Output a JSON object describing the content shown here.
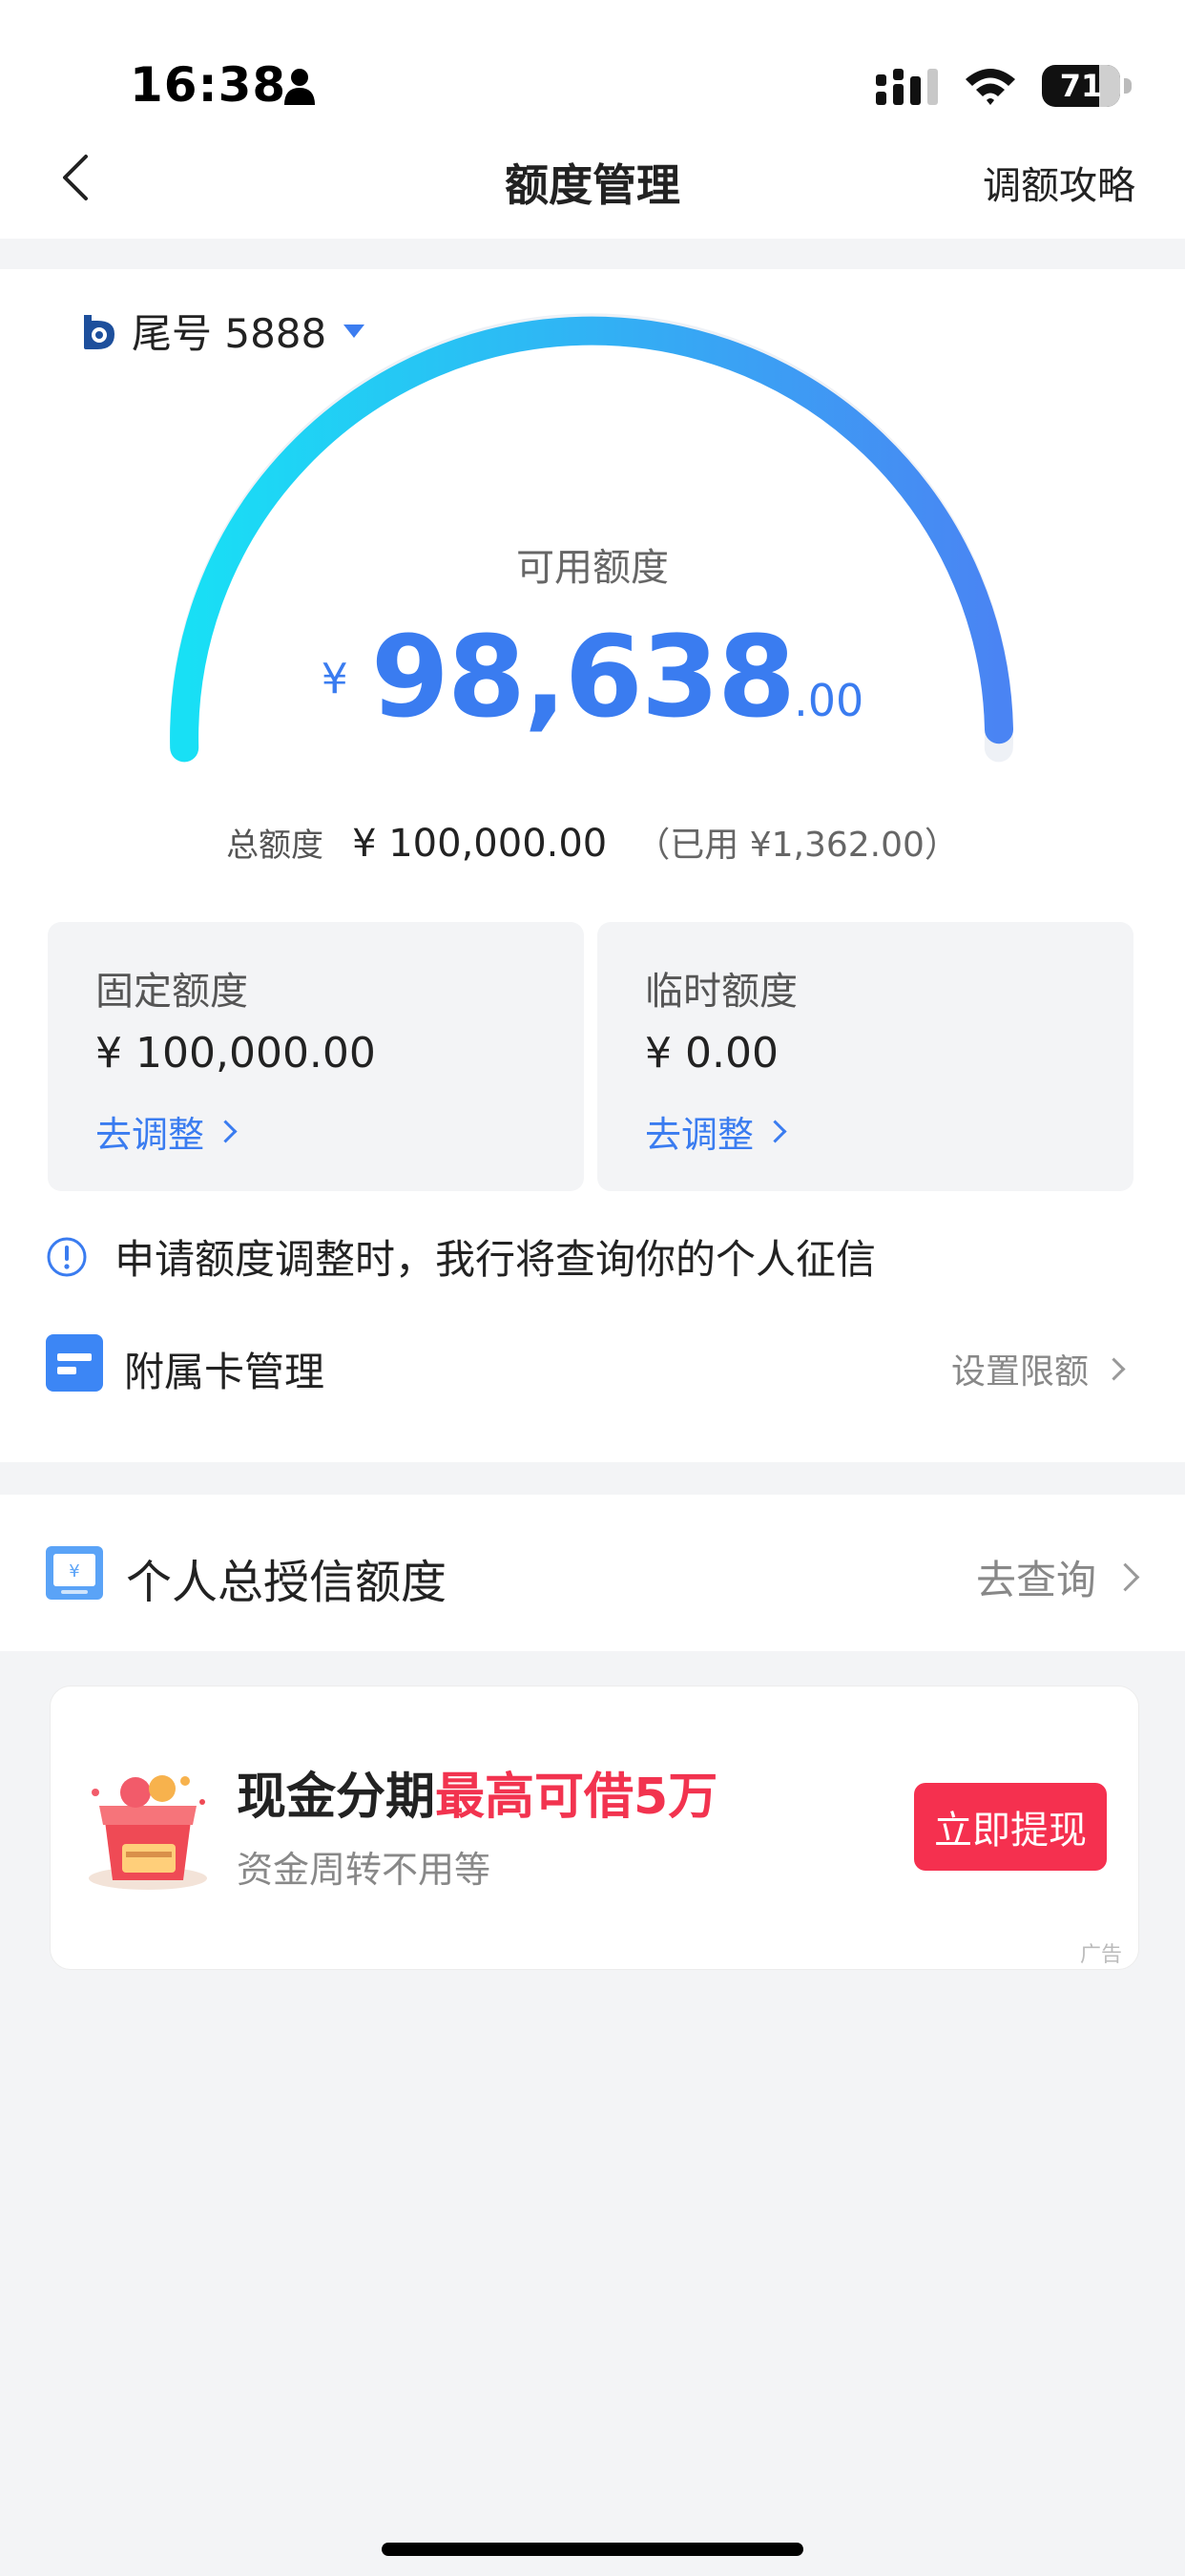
{
  "status_bar": {
    "time": "16:38",
    "battery": "71",
    "icons": [
      "person-icon",
      "cellular-signal-icon",
      "wifi-icon",
      "battery-icon"
    ]
  },
  "nav": {
    "title": "额度管理",
    "right_link": "调额攻略"
  },
  "account": {
    "label": "尾号 5888"
  },
  "available": {
    "label": "可用额度",
    "currency": "¥",
    "integer": "98,638",
    "decimal": ".00",
    "fraction_of_total": 0.986
  },
  "total": {
    "label": "总额度",
    "value": "¥ 100,000.00",
    "used": "（已用 ¥1,362.00）"
  },
  "quota_boxes": [
    {
      "label": "固定额度",
      "value": "¥ 100,000.00",
      "link": "去调整"
    },
    {
      "label": "临时额度",
      "value": "¥ 0.00",
      "link": "去调整"
    }
  ],
  "notice": {
    "text": "申请额度调整时，我行将查询你的个人征信"
  },
  "subcard": {
    "label": "附属卡管理",
    "action": "设置限额"
  },
  "credit": {
    "label": "个人总授信额度",
    "action": "去查询"
  },
  "ad": {
    "title_plain": "现金分期",
    "title_highlight": "最高可借5万",
    "subtitle": "资金周转不用等",
    "button": "立即提现",
    "tag": "广告"
  },
  "colors": {
    "accent_blue": "#3a7cf0",
    "gauge_start": "#18e0f5",
    "gauge_end": "#4a84f3",
    "ad_red": "#f5304f"
  }
}
